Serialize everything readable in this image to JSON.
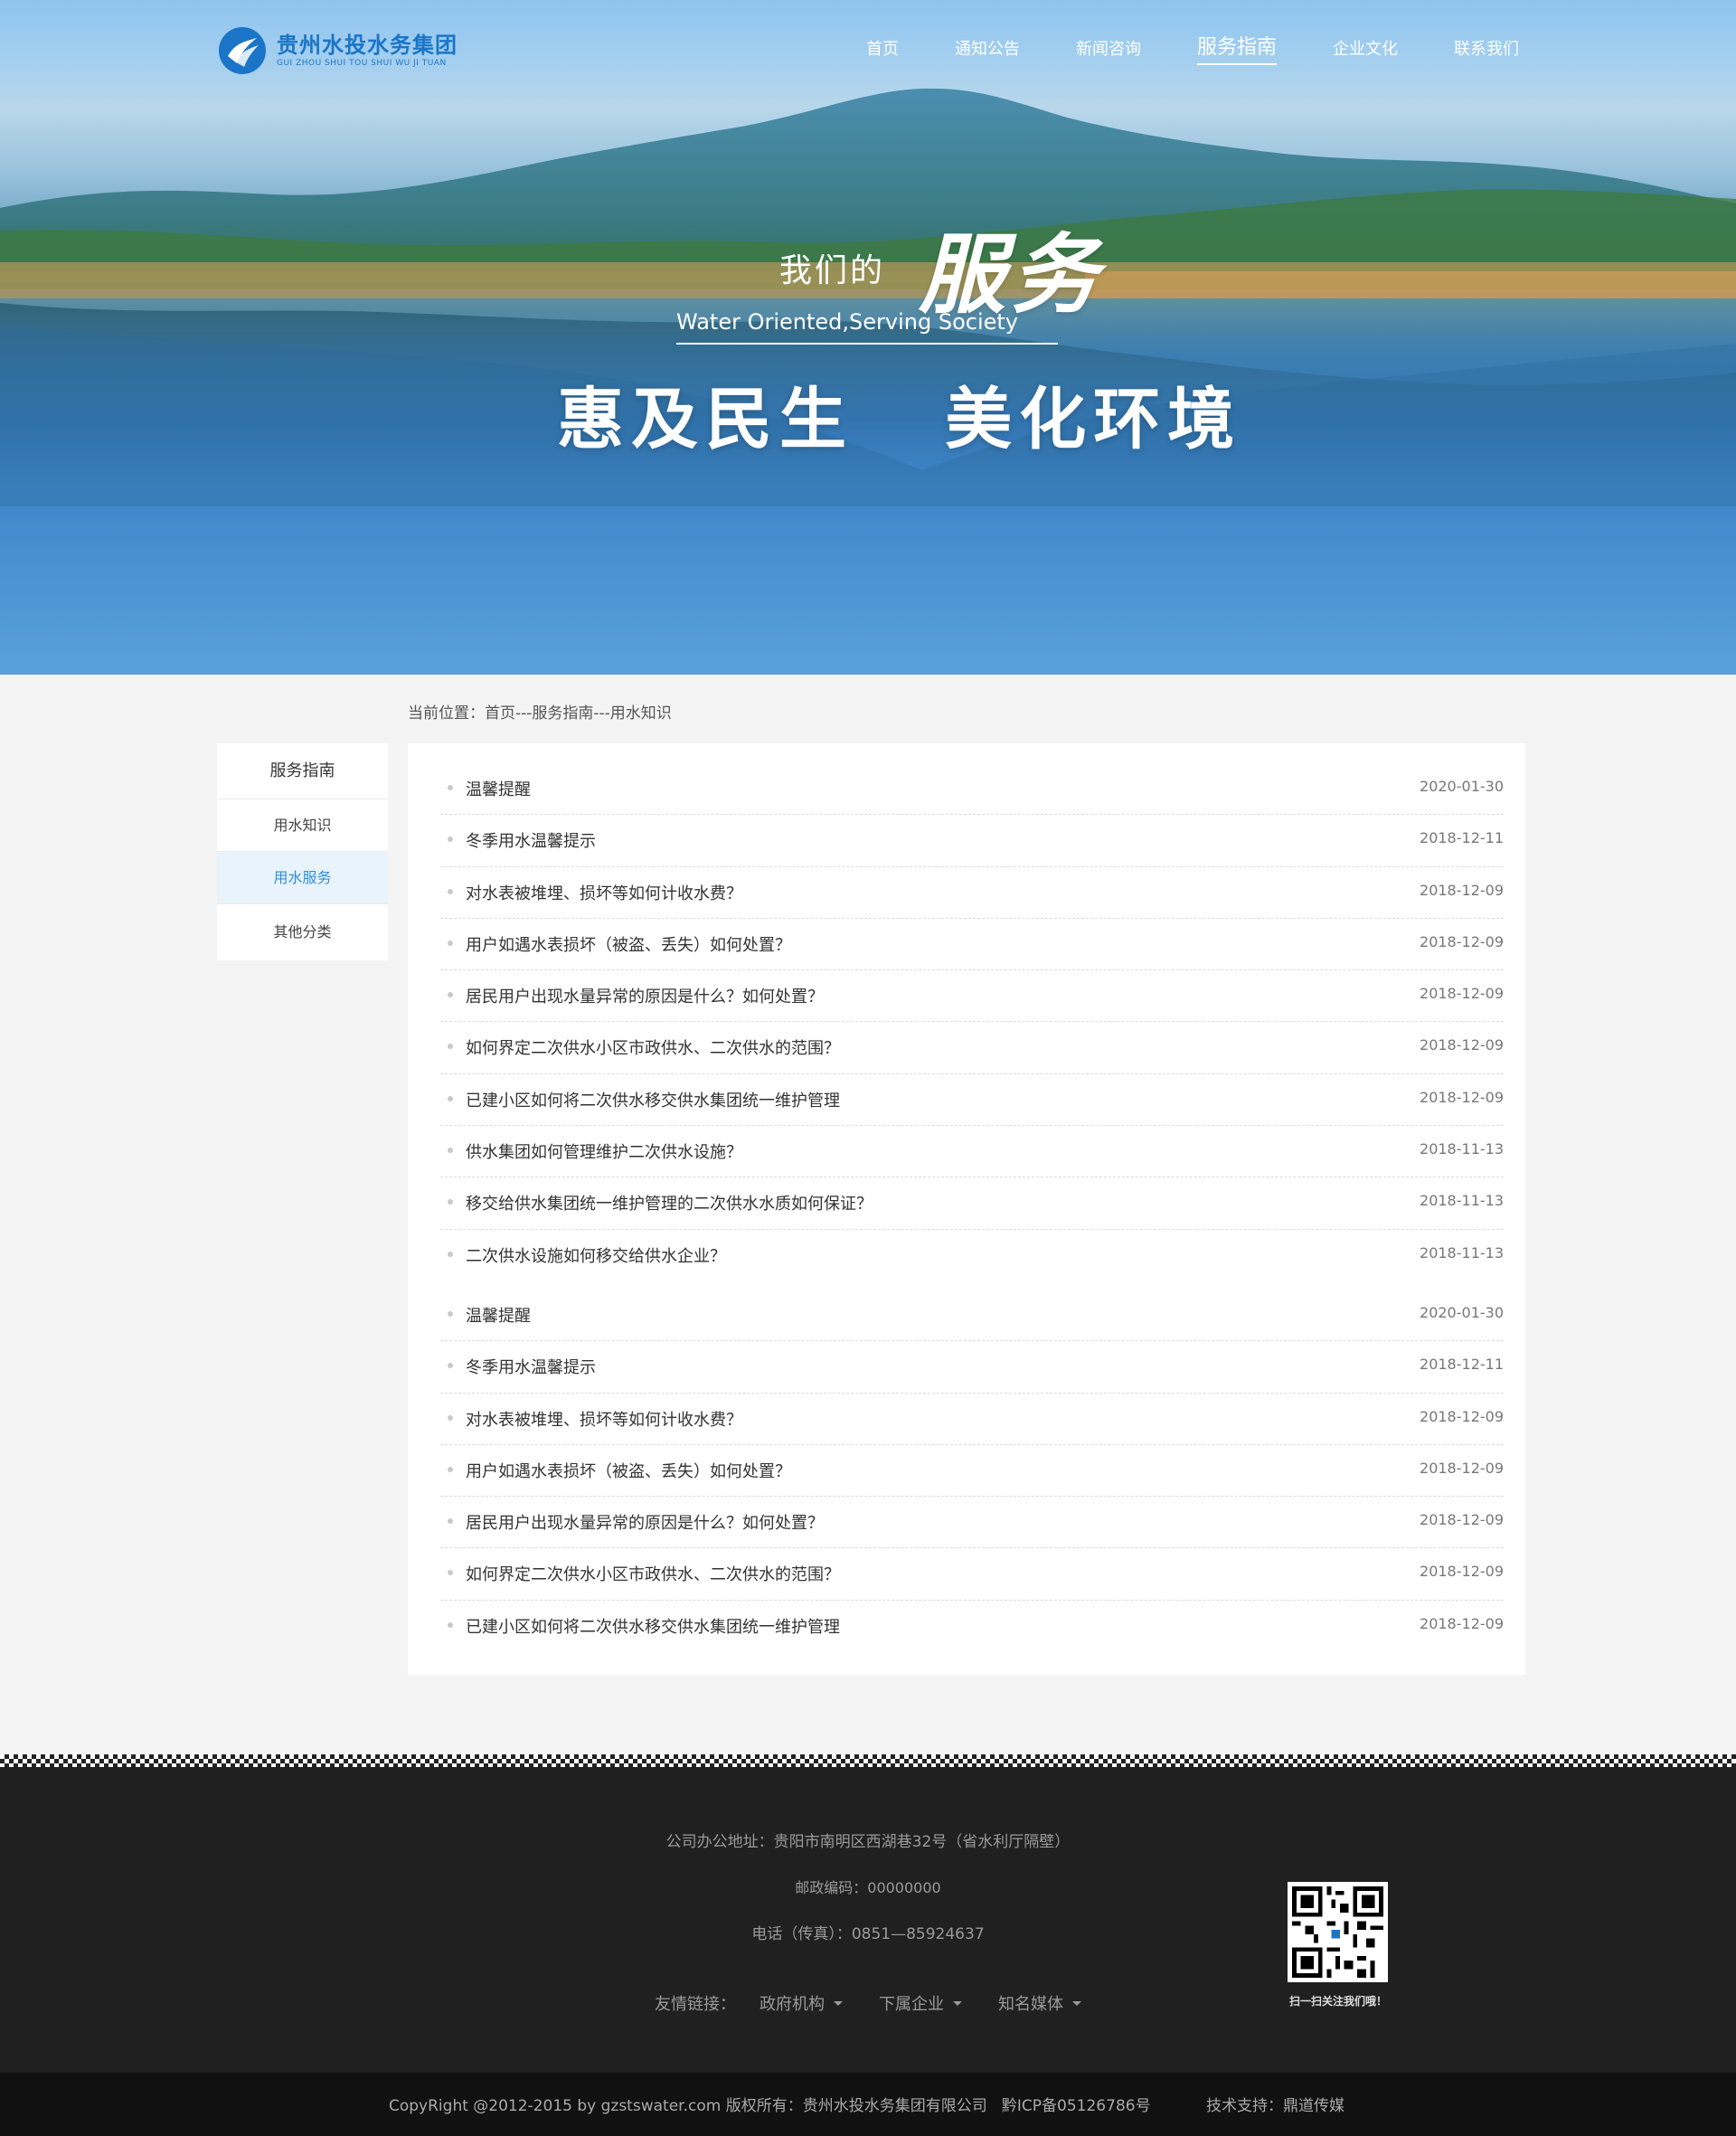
{
  "logo": {
    "cn": "贵州水投水务集团",
    "en": "GUI ZHOU SHUI TOU SHUI WU JI TUAN"
  },
  "nav": [
    "首页",
    "通知公告",
    "新闻咨询",
    "服务指南",
    "企业文化",
    "联系我们"
  ],
  "nav_active": "服务指南",
  "hero": {
    "ours": "我们的",
    "serve": "服务",
    "english": "Water Oriented,Serving Society",
    "main": "惠及民生   美化环境"
  },
  "breadcrumb": "当前位置：首页---服务指南---用水知识",
  "sidebar": {
    "title": "服务指南",
    "items": [
      "用水知识",
      "用水服务",
      "其他分类"
    ],
    "active": "用水服务"
  },
  "list1": [
    {
      "title": "温馨提醒",
      "date": "2020-01-30"
    },
    {
      "title": "冬季用水温馨提示",
      "date": "2018-12-11"
    },
    {
      "title": "对水表被堆埋、损坏等如何计收水费？",
      "date": "2018-12-09"
    },
    {
      "title": "用户如遇水表损坏（被盗、丢失）如何处置？",
      "date": "2018-12-09"
    },
    {
      "title": "居民用户出现水量异常的原因是什么？如何处置？",
      "date": "2018-12-09"
    },
    {
      "title": "如何界定二次供水小区市政供水、二次供水的范围？",
      "date": "2018-12-09"
    },
    {
      "title": "已建小区如何将二次供水移交供水集团统一维护管理",
      "date": "2018-12-09"
    },
    {
      "title": "供水集团如何管理维护二次供水设施？",
      "date": "2018-11-13"
    },
    {
      "title": "移交给供水集团统一维护管理的二次供水水质如何保证？",
      "date": "2018-11-13"
    },
    {
      "title": "二次供水设施如何移交给供水企业？",
      "date": "2018-11-13"
    }
  ],
  "list2": [
    {
      "title": "温馨提醒",
      "date": "2020-01-30"
    },
    {
      "title": "冬季用水温馨提示",
      "date": "2018-12-11"
    },
    {
      "title": "对水表被堆埋、损坏等如何计收水费？",
      "date": "2018-12-09"
    },
    {
      "title": "用户如遇水表损坏（被盗、丢失）如何处置？",
      "date": "2018-12-09"
    },
    {
      "title": "居民用户出现水量异常的原因是什么？如何处置？",
      "date": "2018-12-09"
    },
    {
      "title": "如何界定二次供水小区市政供水、二次供水的范围？",
      "date": "2018-12-09"
    },
    {
      "title": "已建小区如何将二次供水移交供水集团统一维护管理",
      "date": "2018-12-09"
    }
  ],
  "footer": {
    "address": "公司办公地址：贵阳市南明区西湖巷32号（省水利厅隔壁）",
    "zip": "邮政编码：00000000",
    "tel": "电话（传真）：0851—85924637",
    "links_label": "友情链接：",
    "links": [
      "政府机构",
      "下属企业",
      "知名媒体"
    ],
    "qr_caption": "扫一扫关注我们哦！",
    "copyright": "CopyRight @2012-2015 by gzstswater.com 版权所有：贵州水投水务集团有限公司   黔ICP备05126786号",
    "tech": "技术支持：鼎道传媒"
  },
  "colors": {
    "brand": "#1a75c8",
    "active_side": "#2f8ed8",
    "footer_bg": "#202020"
  }
}
